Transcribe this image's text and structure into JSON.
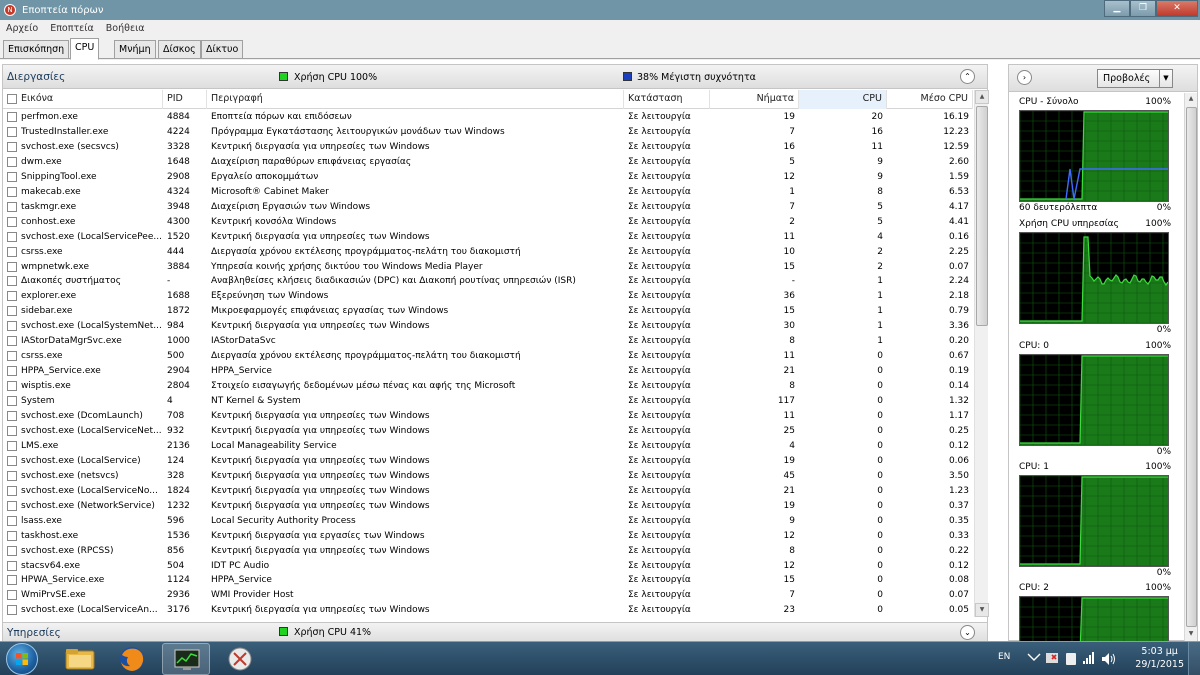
{
  "window": {
    "title": "Εποπτεία πόρων",
    "minimize": "▁",
    "maximize": "❐",
    "close": "✕"
  },
  "menu": [
    "Αρχείο",
    "Εποπτεία",
    "Βοήθεια"
  ],
  "tabs": [
    "Επισκόπηση",
    "CPU",
    "Μνήμη",
    "Δίσκος",
    "Δίκτυο"
  ],
  "active_tab": "CPU",
  "processes": {
    "section_title": "Διεργασίες",
    "cpu_usage_label": "Χρήση CPU 100%",
    "cpu_usage_color": "#21d321",
    "max_freq_label": "38% Μέγιστη συχνότητα",
    "max_freq_color": "#1a3fbf",
    "columns": {
      "image": "Εικόνα",
      "pid": "PID",
      "description": "Περιγραφή",
      "status": "Κατάσταση",
      "threads": "Νήματα",
      "cpu": "CPU",
      "avg_cpu": "Μέσο CPU"
    },
    "rows": [
      [
        "perfmon.exe",
        "4884",
        "Εποπτεία πόρων και επιδόσεων",
        "Σε λειτουργία",
        "19",
        "20",
        "16.19"
      ],
      [
        "TrustedInstaller.exe",
        "4224",
        "Πρόγραμμα Εγκατάστασης λειτουργικών μονάδων των Windows",
        "Σε λειτουργία",
        "7",
        "16",
        "12.23"
      ],
      [
        "svchost.exe (secsvcs)",
        "3328",
        "Κεντρική διεργασία για υπηρεσίες των Windows",
        "Σε λειτουργία",
        "16",
        "11",
        "12.59"
      ],
      [
        "dwm.exe",
        "1648",
        "Διαχείριση παραθύρων επιφάνειας εργασίας",
        "Σε λειτουργία",
        "5",
        "9",
        "2.60"
      ],
      [
        "SnippingTool.exe",
        "2908",
        "Εργαλείο αποκομμάτων",
        "Σε λειτουργία",
        "12",
        "9",
        "1.59"
      ],
      [
        "makecab.exe",
        "4324",
        "Microsoft® Cabinet Maker",
        "Σε λειτουργία",
        "1",
        "8",
        "6.53"
      ],
      [
        "taskmgr.exe",
        "3948",
        "Διαχείριση Εργασιών των Windows",
        "Σε λειτουργία",
        "7",
        "5",
        "4.17"
      ],
      [
        "conhost.exe",
        "4300",
        "Κεντρική κονσόλα Windows",
        "Σε λειτουργία",
        "2",
        "5",
        "4.41"
      ],
      [
        "svchost.exe (LocalServicePee...",
        "1520",
        "Κεντρική διεργασία για υπηρεσίες των Windows",
        "Σε λειτουργία",
        "11",
        "4",
        "0.16"
      ],
      [
        "csrss.exe",
        "444",
        "Διεργασία χρόνου εκτέλεσης προγράμματος-πελάτη του διακομιστή",
        "Σε λειτουργία",
        "10",
        "2",
        "2.25"
      ],
      [
        "wmpnetwk.exe",
        "3884",
        "Υπηρεσία κοινής χρήσης δικτύου του Windows Media Player",
        "Σε λειτουργία",
        "15",
        "2",
        "0.07"
      ],
      [
        "Διακοπές συστήματος",
        "-",
        "Αναβληθείσες κλήσεις διαδικασιών (DPC) και Διακοπή ρουτίνας υπηρεσιών (ISR)",
        "Σε λειτουργία",
        "-",
        "1",
        "2.24"
      ],
      [
        "explorer.exe",
        "1688",
        "Εξερεύνηση των Windows",
        "Σε λειτουργία",
        "36",
        "1",
        "2.18"
      ],
      [
        "sidebar.exe",
        "1872",
        "Μικροεφαρμογές επιφάνειας εργασίας των Windows",
        "Σε λειτουργία",
        "15",
        "1",
        "0.79"
      ],
      [
        "svchost.exe (LocalSystemNet...",
        "984",
        "Κεντρική διεργασία για υπηρεσίες των Windows",
        "Σε λειτουργία",
        "30",
        "1",
        "3.36"
      ],
      [
        "IAStorDataMgrSvc.exe",
        "1000",
        "IAStorDataSvc",
        "Σε λειτουργία",
        "8",
        "1",
        "0.20"
      ],
      [
        "csrss.exe",
        "500",
        "Διεργασία χρόνου εκτέλεσης προγράμματος-πελάτη του διακομιστή",
        "Σε λειτουργία",
        "11",
        "0",
        "0.67"
      ],
      [
        "HPPA_Service.exe",
        "2904",
        "HPPA_Service",
        "Σε λειτουργία",
        "21",
        "0",
        "0.19"
      ],
      [
        "wisptis.exe",
        "2804",
        "Στοιχείο εισαγωγής δεδομένων μέσω πένας και αφής της Microsoft",
        "Σε λειτουργία",
        "8",
        "0",
        "0.14"
      ],
      [
        "System",
        "4",
        "NT Kernel & System",
        "Σε λειτουργία",
        "117",
        "0",
        "1.32"
      ],
      [
        "svchost.exe (DcomLaunch)",
        "708",
        "Κεντρική διεργασία για υπηρεσίες των Windows",
        "Σε λειτουργία",
        "11",
        "0",
        "1.17"
      ],
      [
        "svchost.exe (LocalServiceNet...",
        "932",
        "Κεντρική διεργασία για υπηρεσίες των Windows",
        "Σε λειτουργία",
        "25",
        "0",
        "0.25"
      ],
      [
        "LMS.exe",
        "2136",
        "Local Manageability Service",
        "Σε λειτουργία",
        "4",
        "0",
        "0.12"
      ],
      [
        "svchost.exe (LocalService)",
        "124",
        "Κεντρική διεργασία για υπηρεσίες των Windows",
        "Σε λειτουργία",
        "19",
        "0",
        "0.06"
      ],
      [
        "svchost.exe (netsvcs)",
        "328",
        "Κεντρική διεργασία για υπηρεσίες των Windows",
        "Σε λειτουργία",
        "45",
        "0",
        "3.50"
      ],
      [
        "svchost.exe (LocalServiceNo...",
        "1824",
        "Κεντρική διεργασία για υπηρεσίες των Windows",
        "Σε λειτουργία",
        "21",
        "0",
        "1.23"
      ],
      [
        "svchost.exe (NetworkService)",
        "1232",
        "Κεντρική διεργασία για υπηρεσίες των Windows",
        "Σε λειτουργία",
        "19",
        "0",
        "0.37"
      ],
      [
        "lsass.exe",
        "596",
        "Local Security Authority Process",
        "Σε λειτουργία",
        "9",
        "0",
        "0.35"
      ],
      [
        "taskhost.exe",
        "1536",
        "Κεντρική διεργασία για εργασίες των Windows",
        "Σε λειτουργία",
        "12",
        "0",
        "0.33"
      ],
      [
        "svchost.exe (RPCSS)",
        "856",
        "Κεντρική διεργασία για υπηρεσίες των Windows",
        "Σε λειτουργία",
        "8",
        "0",
        "0.22"
      ],
      [
        "stacsv64.exe",
        "504",
        "IDT PC Audio",
        "Σε λειτουργία",
        "12",
        "0",
        "0.12"
      ],
      [
        "HPWA_Service.exe",
        "1124",
        "HPPA_Service",
        "Σε λειτουργία",
        "15",
        "0",
        "0.08"
      ],
      [
        "WmiPrvSE.exe",
        "2936",
        "WMI Provider Host",
        "Σε λειτουργία",
        "7",
        "0",
        "0.07"
      ],
      [
        "svchost.exe (LocalServiceAn...",
        "3176",
        "Κεντρική διεργασία για υπηρεσίες των Windows",
        "Σε λειτουργία",
        "23",
        "0",
        "0.05"
      ]
    ]
  },
  "services": {
    "section_title": "Υπηρεσίες",
    "cpu_usage_label": "Χρήση CPU 41%",
    "cpu_usage_color": "#21d321"
  },
  "right_panel": {
    "views_label": "Προβολές",
    "graphs": [
      {
        "label": "CPU - Σύνολο",
        "top_pct": "100%",
        "bottom_left": "60 δευτερόλεπτα",
        "bottom_pct": "0%"
      },
      {
        "label": "Χρήση CPU υπηρεσίας",
        "top_pct": "100%",
        "bottom_left": "",
        "bottom_pct": "0%"
      },
      {
        "label": "CPU: 0",
        "top_pct": "100%",
        "bottom_left": "",
        "bottom_pct": "0%"
      },
      {
        "label": "CPU: 1",
        "top_pct": "100%",
        "bottom_left": "",
        "bottom_pct": "0%"
      },
      {
        "label": "CPU: 2",
        "top_pct": "100%",
        "bottom_left": "",
        "bottom_pct": ""
      }
    ]
  },
  "taskbar": {
    "language": "EN",
    "time": "5:03 μμ",
    "date": "29/1/2015"
  }
}
